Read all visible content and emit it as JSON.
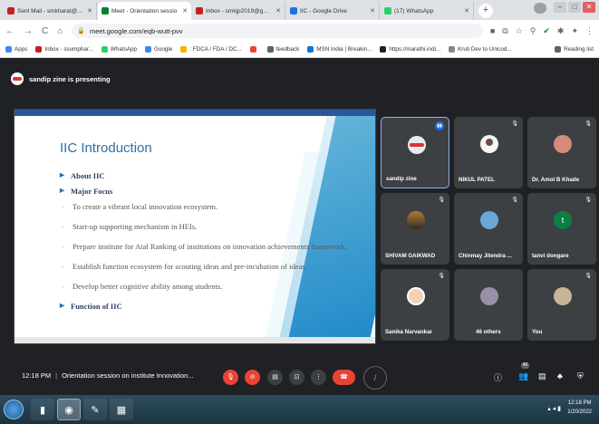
{
  "browser": {
    "tabs": [
      {
        "label": "Sent Mail - smkharat@gmail.c",
        "color": "#c5221f",
        "active": false
      },
      {
        "label": "Meet - Orientation sessio",
        "color": "#00832d",
        "active": true
      },
      {
        "label": "Inbox - smkjp2019@gmail.co",
        "color": "#c5221f",
        "active": false
      },
      {
        "label": "IIC - Google Drive",
        "color": "#1a73e8",
        "active": false
      },
      {
        "label": "(17) WhatsApp",
        "color": "#25d366",
        "active": false
      }
    ],
    "new_tab": "+",
    "url": "meet.google.com/eqb-wutt-pvv",
    "bookmarks": [
      {
        "label": "Apps",
        "color": "#4285f4"
      },
      {
        "label": "Inbox - ssumphar...",
        "color": "#c5221f"
      },
      {
        "label": "WhatsApp",
        "color": "#25d366"
      },
      {
        "label": "Google",
        "color": "#4285f4"
      },
      {
        "label": ": FDCA / FDA / DC...",
        "color": "#f4b400"
      },
      {
        "label": "",
        "color": "#ea4335"
      },
      {
        "label": "feedback",
        "color": "#5f6368"
      },
      {
        "label": "MSN India | Breakin...",
        "color": "#0078d7"
      },
      {
        "label": "https://marathi.indi...",
        "color": "#222"
      },
      {
        "label": "Kruti Dev to Unicod...",
        "color": "#888"
      }
    ],
    "reading_list": "Reading list"
  },
  "meet": {
    "presenter_text": "sandip zine is presenting",
    "slide": {
      "title": "IIC Introduction",
      "items": [
        {
          "text": "About IIC",
          "kind": "bullet"
        },
        {
          "text": "Major Focus",
          "kind": "bullet"
        },
        {
          "text": "To create a vibrant local innovation ecosystem.",
          "kind": "sub"
        },
        {
          "text": "Start-up supporting mechanism in HEIs.",
          "kind": "sub"
        },
        {
          "text": "Prepare institute for Atal Ranking of institutions on innovation achievements framework.",
          "kind": "sub"
        },
        {
          "text": "Establish function ecosystem for scouting ideas and pre-incubation of ideas.",
          "kind": "sub"
        },
        {
          "text": "Develop better cognitive ability among students.",
          "kind": "sub"
        },
        {
          "text": "Function of IIC",
          "kind": "bullet"
        }
      ]
    },
    "participants": [
      {
        "name": "sandip zine",
        "color": "#e8eaed",
        "speaking": true
      },
      {
        "name": "NIKUL PATEL",
        "color": "#f5f5f5",
        "speaking": false
      },
      {
        "name": "Dr. Amol B Khade",
        "color": "#d98a7a",
        "speaking": false
      },
      {
        "name": "SHIVAM GAIKWAD",
        "color": "#b8792f",
        "speaking": false
      },
      {
        "name": "Chinmay Jitendra ...",
        "color": "#6aa7d8",
        "speaking": false
      },
      {
        "name": "tanvi dongare",
        "color": "#0b8043",
        "initial": "t",
        "speaking": false
      },
      {
        "name": "Sanika Narvankar",
        "color": "#f2d2b6",
        "speaking": false
      },
      {
        "name": "46 others",
        "color": "#9b8ea7",
        "speaking": false
      },
      {
        "name": "You",
        "color": "#c9b49a",
        "speaking": false
      }
    ],
    "time": "12:18 PM",
    "meeting_title": "Orientation session on institute Innovation...",
    "people_count": "46"
  },
  "taskbar": {
    "clock_time": "12:18 PM",
    "clock_date": "1/20/2022"
  }
}
